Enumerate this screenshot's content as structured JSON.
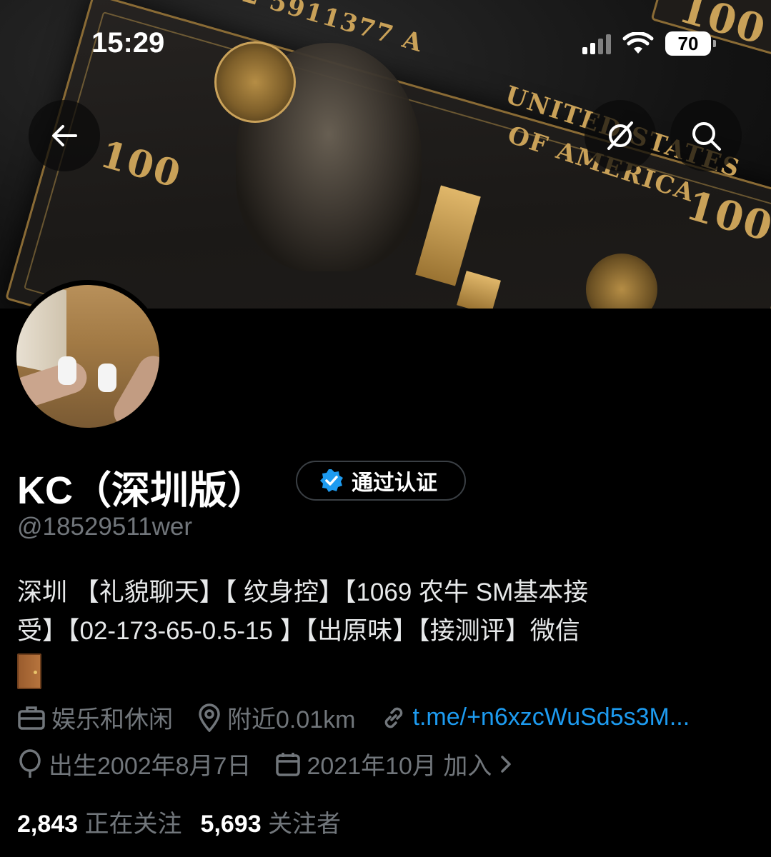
{
  "status_bar": {
    "time": "15:29",
    "battery": "70"
  },
  "banner": {
    "image": "hundred-dollar-bill",
    "note_serial": "B2 5911377 A",
    "note_text_1": "UNITED STATES",
    "note_text_2": "OF AMERICA",
    "note_value": "100"
  },
  "header_buttons": {
    "back": "back-arrow-icon",
    "grok": "grok-icon",
    "search": "search-icon"
  },
  "profile": {
    "display_name": "KC（深圳版）",
    "verified_label": "通过认证",
    "handle": "@18529511wer",
    "bio": "深圳 【礼貌聊天】【 纹身控】【1069 农牛 SM基本接\n受】【02-173-65-0.5-15 】【出原味】【接测评】微信",
    "bio_emoji": "door-emoji",
    "category": "娱乐和休闲",
    "location": "附近0.01km",
    "link": "t.me/+n6xzcWuSd5s3M...",
    "birth": "出生2002年8月7日",
    "joined": "2021年10月 加入",
    "following_count": "2,843",
    "following_label": "正在关注",
    "followers_count": "5,693",
    "followers_label": "关注者"
  },
  "colors": {
    "background": "#000000",
    "text": "#e7e9ea",
    "muted": "#71767b",
    "link": "#1d9bf0",
    "verified": "#1d9bf0"
  }
}
